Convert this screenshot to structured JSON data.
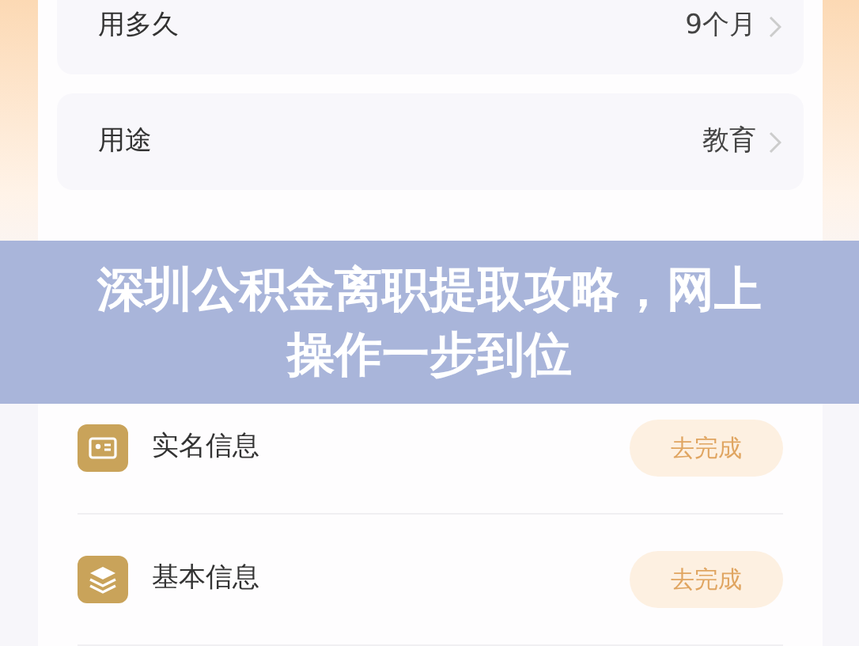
{
  "settings_rows": [
    {
      "label": "用多久",
      "value": "9个月"
    },
    {
      "label": "用途",
      "value": "教育"
    }
  ],
  "auth_items": [
    {
      "label": "实名信息",
      "kind": "id-card",
      "action": "去完成"
    },
    {
      "label": "基本信息",
      "kind": "layers",
      "action": "去完成"
    }
  ],
  "banner": {
    "title": "深圳公积金离职提取攻略，网上操作一步到位"
  }
}
